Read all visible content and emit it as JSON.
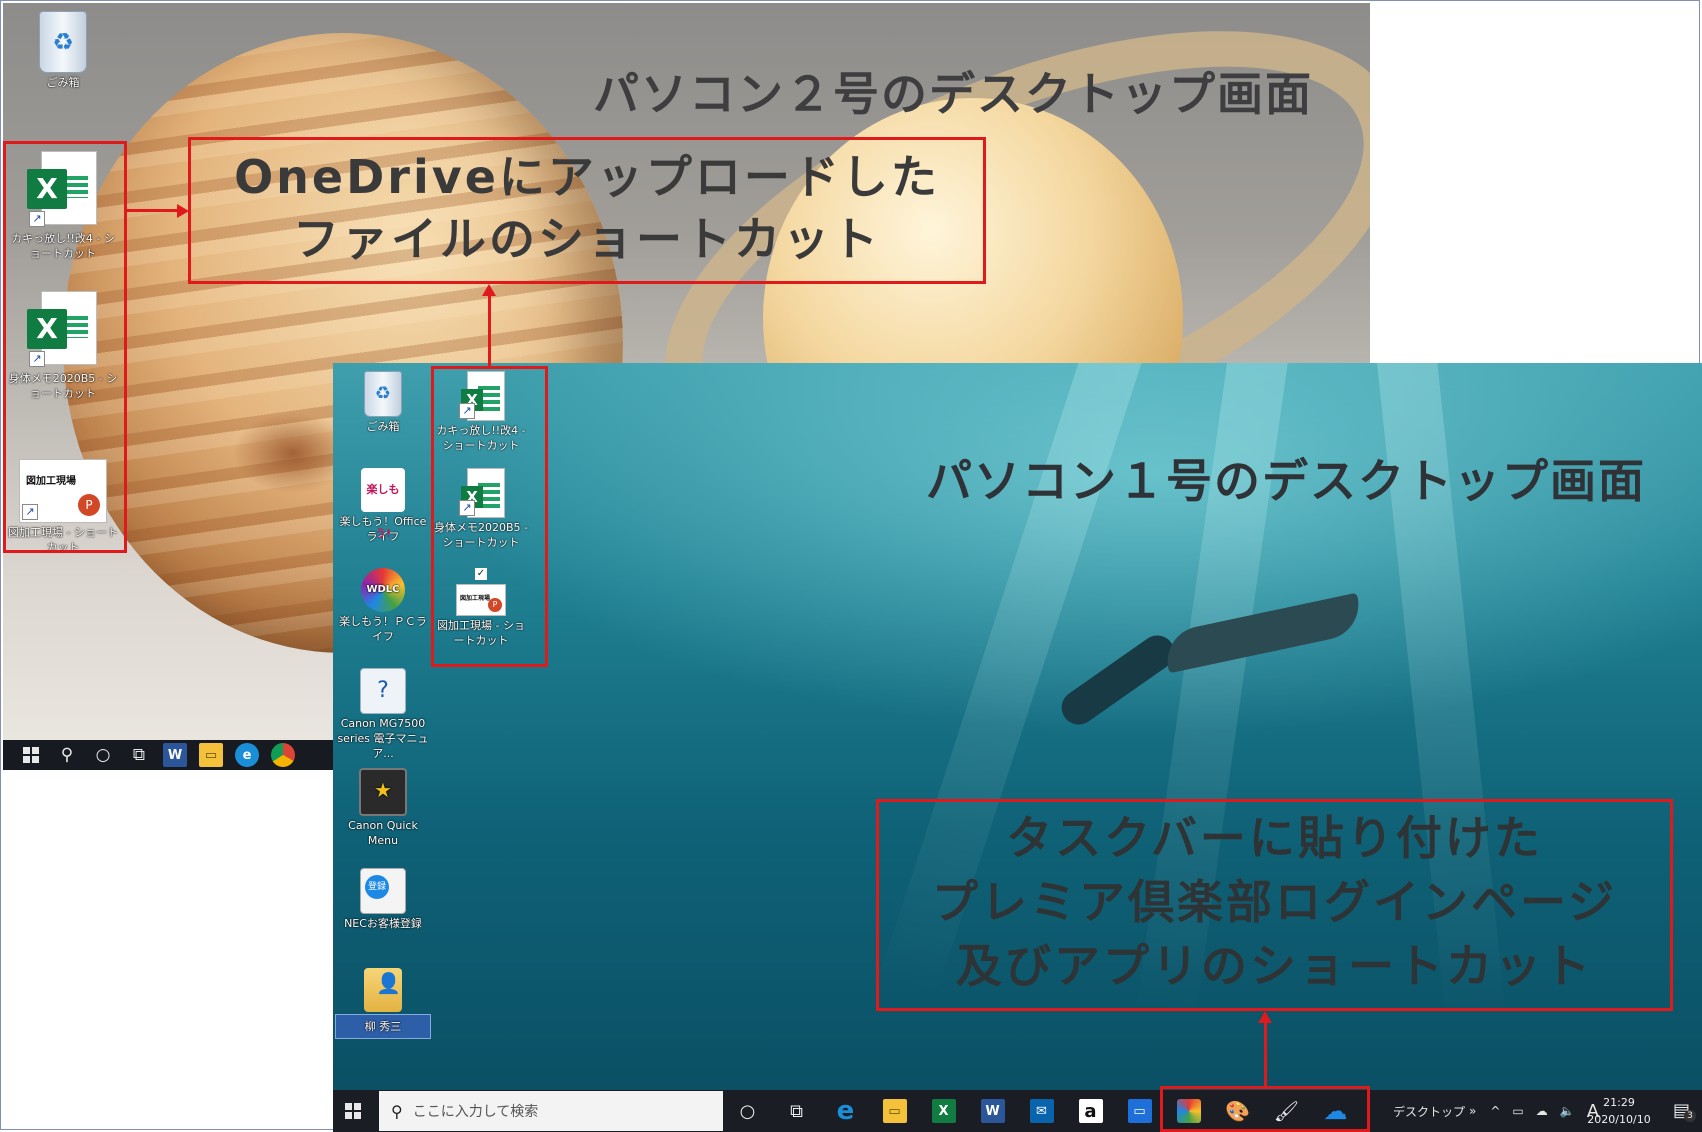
{
  "pc2": {
    "title": "パソコン２号のデスクトップ画面",
    "icons": [
      {
        "label": "ごみ箱"
      },
      {
        "label": "カキっ放し!!改4 - ショートカット"
      },
      {
        "label": "身体メモ2020B5 - ショートカット"
      },
      {
        "label": "図加工現場 - ショートカット",
        "thumb_text": "図加工現場"
      }
    ],
    "taskbar_icons": [
      "windows-logo",
      "search",
      "cortana",
      "task-view",
      "word",
      "file-explorer",
      "edge",
      "chrome"
    ]
  },
  "callout_onedrive": {
    "line1": "OneDriveにアップロードした",
    "line2": "ファイルのショートカット"
  },
  "pc1": {
    "title": "パソコン１号のデスクトップ画面",
    "icons_col1": [
      {
        "label": "ごみ箱"
      },
      {
        "label": "楽しもう！Office ライフ",
        "tile_text": "楽しもう!"
      },
      {
        "label": "楽しもう！ＰＣライフ",
        "tile_text": "WDLC"
      },
      {
        "label": "Canon MG7500 series 電子マニュア..."
      },
      {
        "label": "Canon Quick Menu"
      },
      {
        "label": "NECお客様登録",
        "tile_text": "登録"
      },
      {
        "label": "柳 秀三"
      }
    ],
    "icons_col2": [
      {
        "label": "カキっ放し!!改4 - ショートカット"
      },
      {
        "label": "身体メモ2020B5 - ショートカット"
      },
      {
        "label": "図加工現場 - ショートカット",
        "thumb_text": "図加工現場"
      }
    ],
    "taskbar": {
      "search_placeholder": "ここに入力して検索",
      "apps": [
        "cortana",
        "task-view",
        "edge",
        "file-explorer",
        "excel",
        "word",
        "outlook",
        "amazon",
        "window-app"
      ],
      "pinned": [
        "premier-club-page",
        "paint-app",
        "paint-app-2",
        "onedrive"
      ],
      "toolbar_label": "デスクトップ",
      "ime": "A",
      "time": "21:29",
      "date": "2020/10/10",
      "notification_count": "3"
    }
  },
  "callout_taskbar": {
    "line1": "タスクバーに貼り付けた",
    "line2": "プレミア倶楽部ログインページ",
    "line3": "及びアプリのショートカット"
  },
  "colors": {
    "callout_red": "#e0191b",
    "taskbar": "#1b1d25",
    "excel_green": "#107c41"
  }
}
